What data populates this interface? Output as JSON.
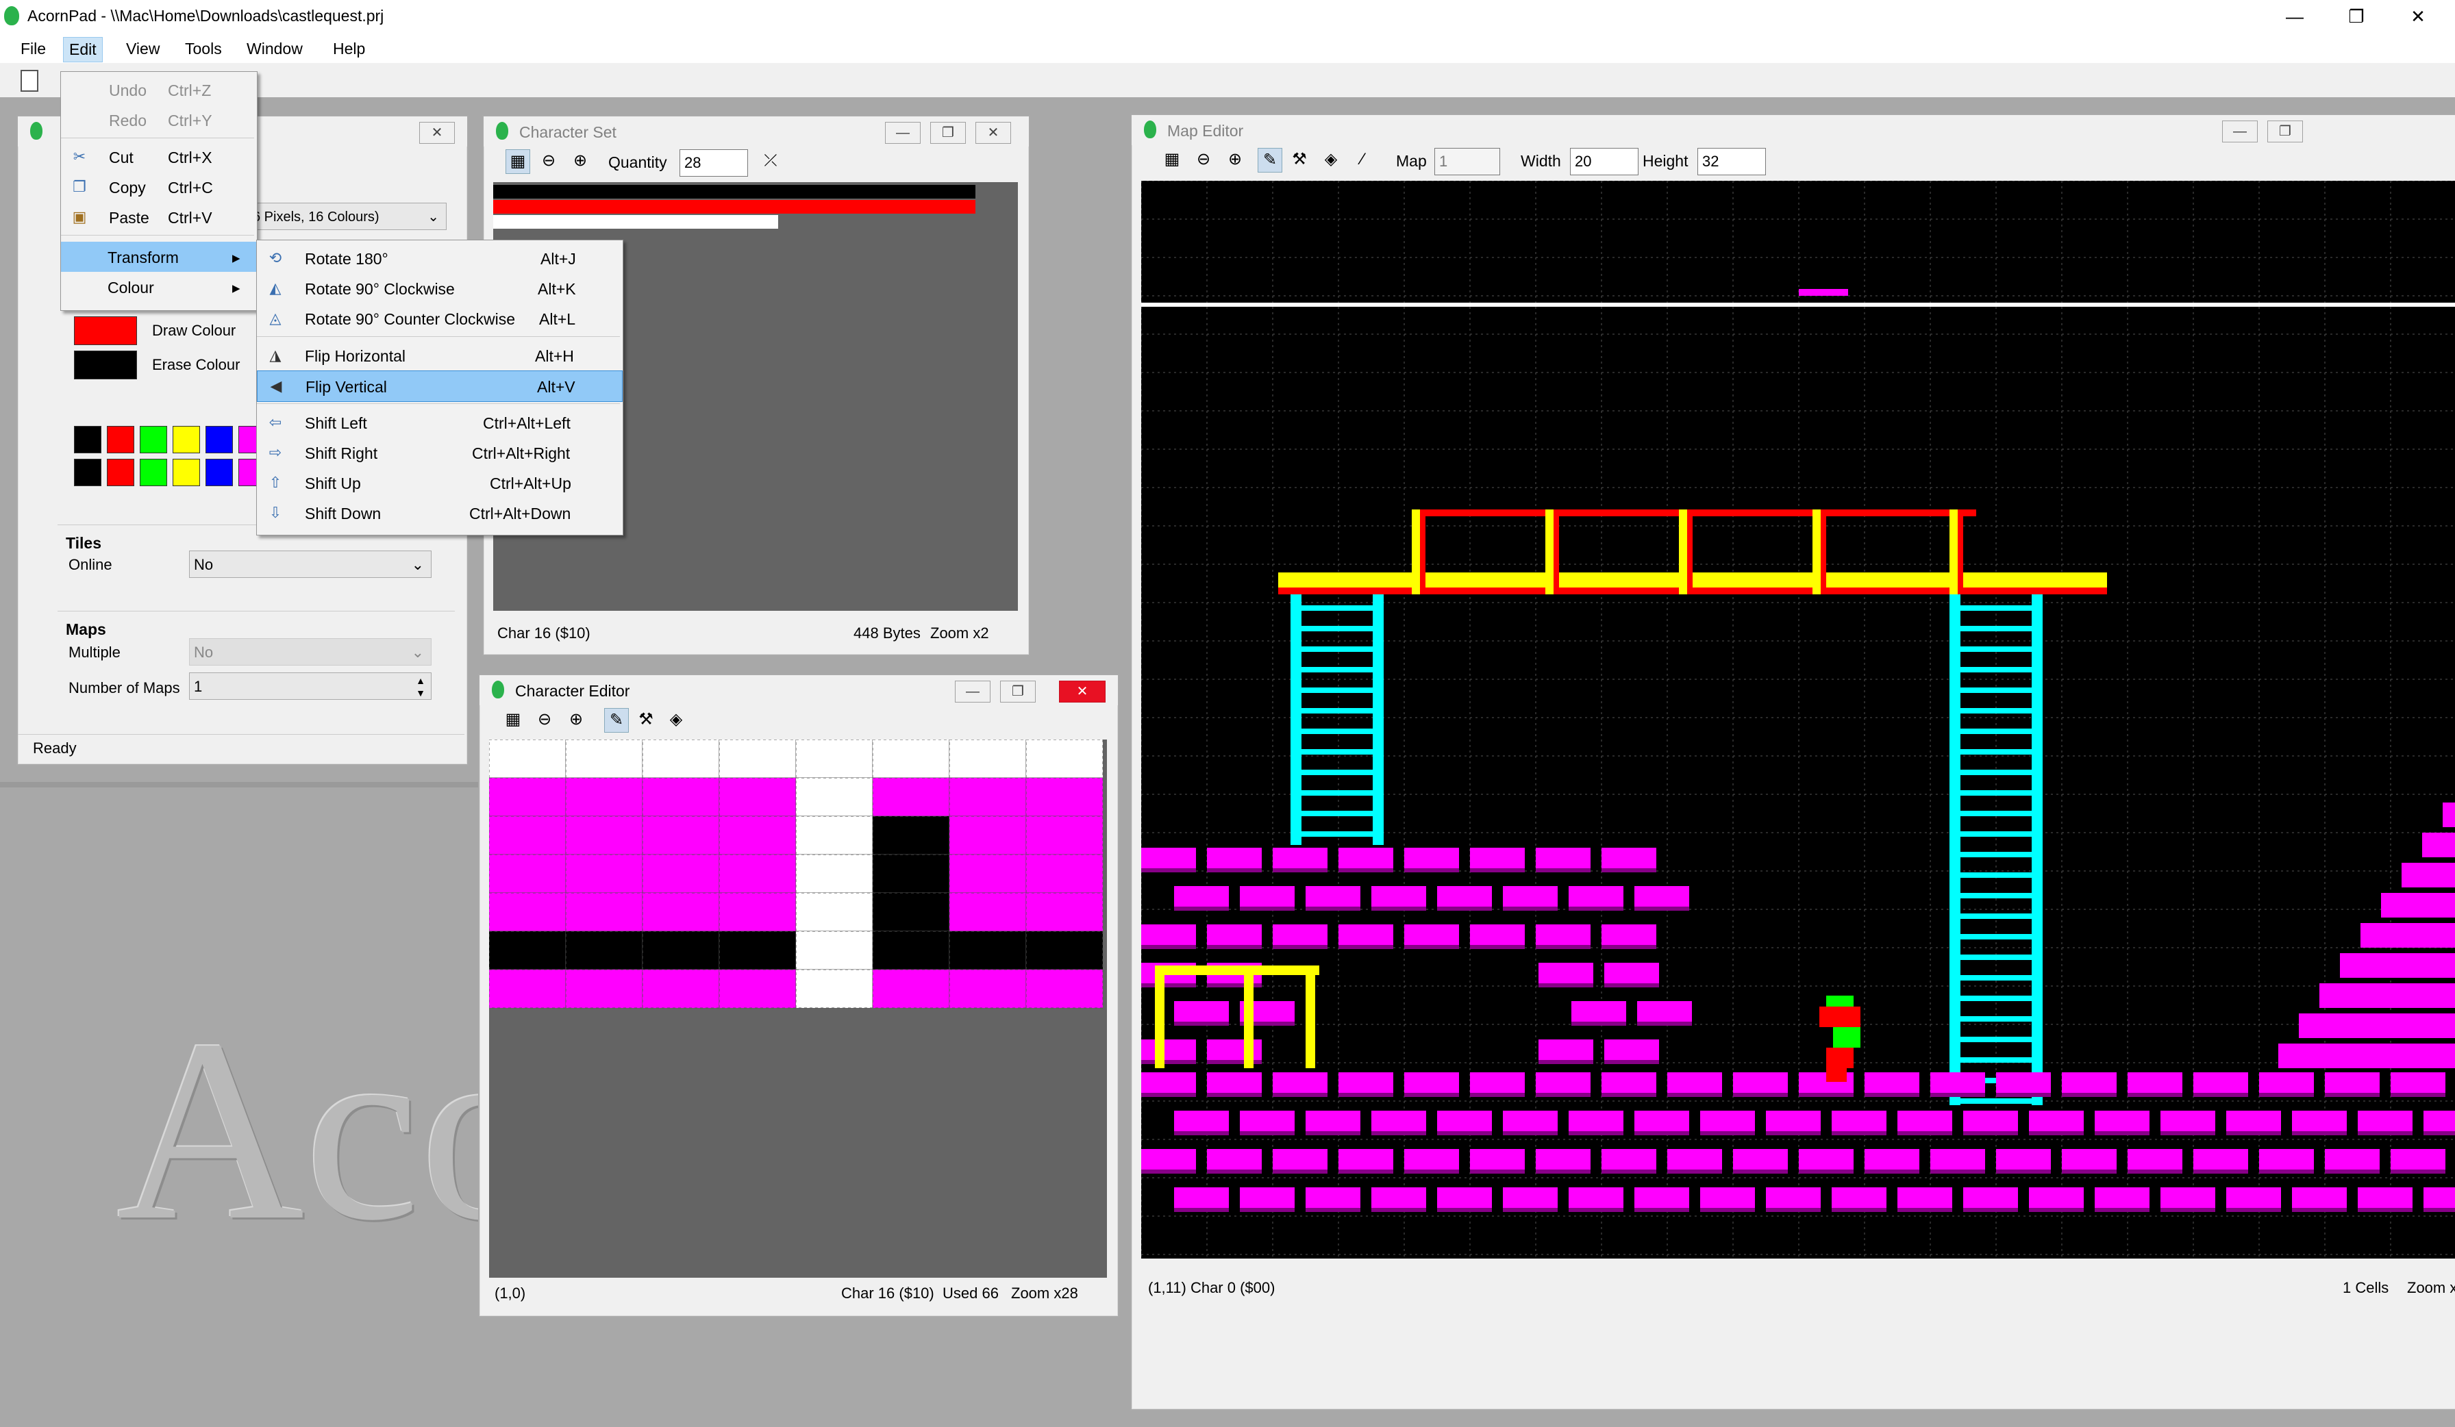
{
  "titlebar": {
    "title": "AcornPad - \\\\Mac\\Home\\Downloads\\castlequest.prj",
    "minimize": "—",
    "maximize": "❐",
    "close": "✕"
  },
  "menubar": [
    "File",
    "Edit",
    "View",
    "Tools",
    "Window",
    "Help"
  ],
  "edit_menu": {
    "items": [
      {
        "label": "Undo",
        "shortcut": "Ctrl+Z",
        "disabled": true
      },
      {
        "label": "Redo",
        "shortcut": "Ctrl+Y",
        "disabled": true
      },
      {
        "label": "Cut",
        "shortcut": "Ctrl+X"
      },
      {
        "label": "Copy",
        "shortcut": "Ctrl+C"
      },
      {
        "label": "Paste",
        "shortcut": "Ctrl+V"
      },
      {
        "label": "Transform",
        "arrow": "▸"
      },
      {
        "label": "Colour",
        "arrow": "▸"
      }
    ]
  },
  "transform_menu": {
    "items": [
      {
        "label": "Rotate 180°",
        "shortcut": "Alt+J"
      },
      {
        "label": "Rotate 90° Clockwise",
        "shortcut": "Alt+K"
      },
      {
        "label": "Rotate 90° Counter Clockwise",
        "shortcut": "Alt+L"
      },
      {
        "label": "Flip Horizontal",
        "shortcut": "Alt+H"
      },
      {
        "label": "Flip Vertical",
        "shortcut": "Alt+V"
      },
      {
        "label": "Shift Left",
        "shortcut": "Ctrl+Alt+Left"
      },
      {
        "label": "Shift Right",
        "shortcut": "Ctrl+Alt+Right"
      },
      {
        "label": "Shift Up",
        "shortcut": "Ctrl+Alt+Up"
      },
      {
        "label": "Shift Down",
        "shortcut": "Ctrl+Alt+Down"
      }
    ]
  },
  "project_window": {
    "mode_value": "6 Pixels, 16 Colours)",
    "draw_colour": "Draw Colour",
    "erase_colour": "Erase Colour",
    "draw_colour_hex": "#ff0000",
    "erase_colour_hex": "#000000",
    "palette_row1": [
      "#000000",
      "#ff0000",
      "#00ff00",
      "#ffff00",
      "#0000ff",
      "#ff00ff"
    ],
    "palette_row2": [
      "#000000",
      "#ff0000",
      "#00ff00",
      "#ffff00",
      "#0000ff",
      "#ff00ff"
    ],
    "tiles_header": "Tiles",
    "online_label": "Online",
    "online_value": "No",
    "maps_header": "Maps",
    "multiple_label": "Multiple",
    "multiple_value": "No",
    "number_of_maps_label": "Number of Maps",
    "number_of_maps_value": "1",
    "status": "Ready"
  },
  "character_set": {
    "title": "Character Set",
    "quantity_label": "Quantity",
    "quantity_value": "28",
    "status_left": "Char 16 ($10)",
    "status_bytes": "448 Bytes",
    "status_zoom": "Zoom x2"
  },
  "character_editor": {
    "title": "Character Editor",
    "status_left": "(1,0)",
    "status_char": "Char 16 ($10)",
    "status_used": "Used 66",
    "status_zoom": "Zoom x28"
  },
  "map_editor": {
    "title": "Map Editor",
    "map_label": "Map",
    "map_value": "1",
    "width_label": "Width",
    "width_value": "20",
    "height_label": "Height",
    "height_value": "32",
    "status_left": "(1,11)   Char 0 ($00)",
    "status_cells": "1 Cells",
    "status_zoom": "Zoom x"
  },
  "watermark": "Aco"
}
